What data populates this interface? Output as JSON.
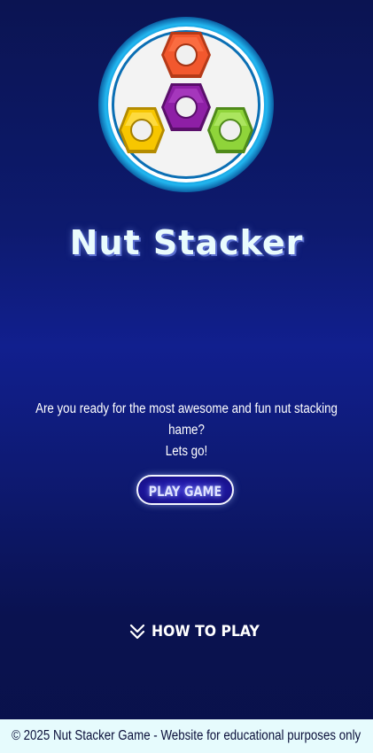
{
  "app": {
    "title": "Nut Stacker"
  },
  "logo": {
    "ring_color": "#1aa7e6",
    "inner_color": "#f2f2f2",
    "nuts": [
      {
        "name": "orange-nut",
        "color": "#f2582e"
      },
      {
        "name": "purple-nut",
        "color": "#8e1fa6"
      },
      {
        "name": "yellow-nut",
        "color": "#f7c600"
      },
      {
        "name": "green-nut",
        "color": "#8fd43a"
      }
    ]
  },
  "hero": {
    "tagline_line1": "Are you ready for the most awesome and fun nut stacking hame?",
    "tagline_line2": "Lets go!"
  },
  "actions": {
    "play_label": "PLAY GAME",
    "how_to_label": "HOW TO PLAY",
    "how_to_icon": "double-chevron-down-icon"
  },
  "footer": {
    "text": "© 2025 Nut Stacker Game - Website for educational purposes only"
  },
  "colors": {
    "background": "#0d1a6e",
    "title": "#e9fbfd",
    "footer_bg": "#e6fbfd",
    "button_fill": "#1d169e"
  }
}
